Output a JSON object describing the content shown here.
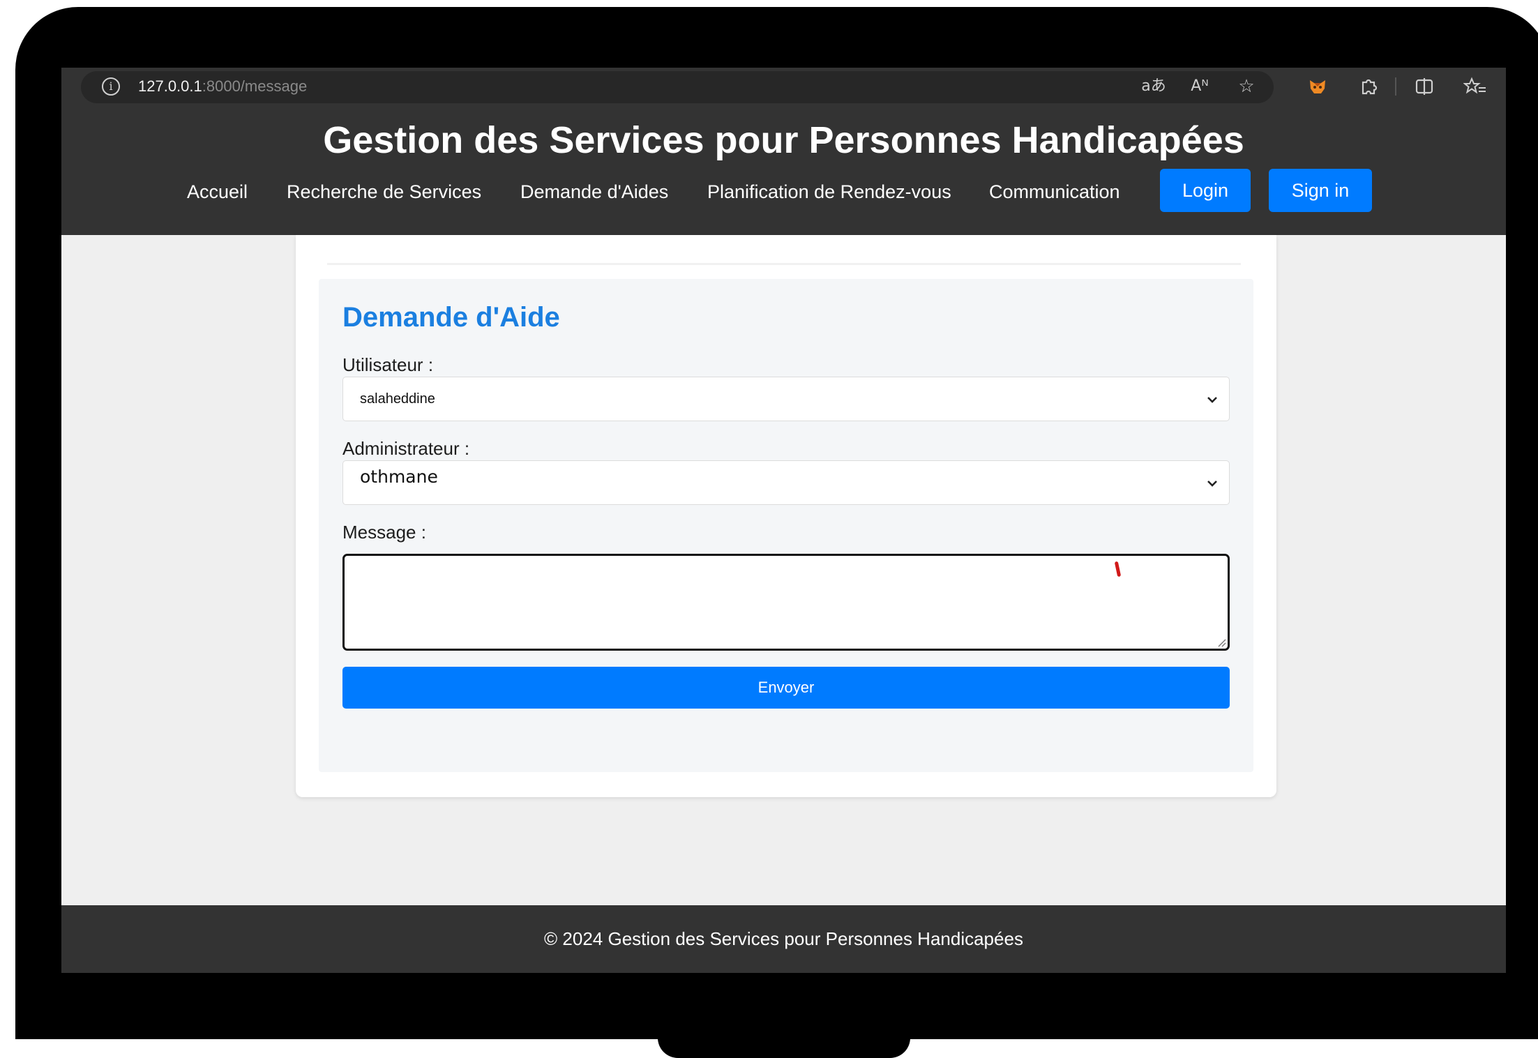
{
  "browser": {
    "url_host": "127.0.0.1",
    "url_path": ":8000/message",
    "icons": {
      "info": "info-icon",
      "translate": "translate-icon",
      "read_aloud": "read-aloud-icon",
      "favorite": "star-icon",
      "extension": "fox-extension-icon",
      "extensions": "puzzle-icon",
      "split": "split-screen-icon",
      "favorites": "favorites-list-icon"
    },
    "translate_glyph": "aあ",
    "read_aloud_glyph": "Aᴺ"
  },
  "header": {
    "title": "Gestion des Services pour Personnes Handicapées",
    "nav": [
      {
        "label": "Accueil"
      },
      {
        "label": "Recherche de Services"
      },
      {
        "label": "Demande d'Aides"
      },
      {
        "label": "Planification de Rendez-vous"
      },
      {
        "label": "Communication"
      }
    ],
    "login_label": "Login",
    "signin_label": "Sign in"
  },
  "form": {
    "title": "Demande d'Aide",
    "user_label": "Utilisateur :",
    "user_value": "salaheddine",
    "admin_label": "Administrateur :",
    "admin_value": "othmane",
    "message_label": "Message :",
    "message_value": "",
    "submit_label": "Envoyer"
  },
  "footer": {
    "text": "© 2024 Gestion des Services pour Personnes Handicapées"
  },
  "colors": {
    "header_bg": "#333333",
    "accent": "#007bff",
    "title_blue": "#1b7fe0",
    "page_bg": "#efefef"
  }
}
